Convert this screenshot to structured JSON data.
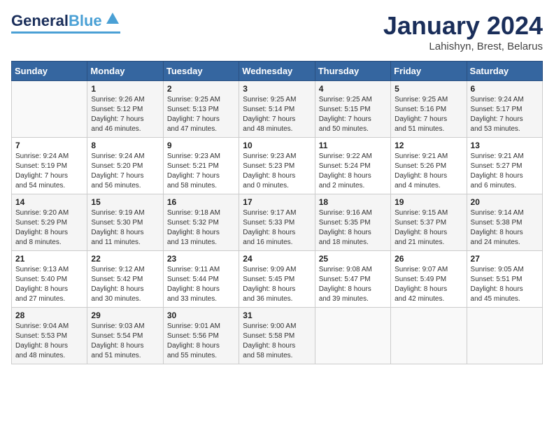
{
  "header": {
    "logo_general": "General",
    "logo_blue": "Blue",
    "month_title": "January 2024",
    "location": "Lahishyn, Brest, Belarus"
  },
  "weekdays": [
    "Sunday",
    "Monday",
    "Tuesday",
    "Wednesday",
    "Thursday",
    "Friday",
    "Saturday"
  ],
  "weeks": [
    [
      {
        "day": "",
        "info": ""
      },
      {
        "day": "1",
        "info": "Sunrise: 9:26 AM\nSunset: 5:12 PM\nDaylight: 7 hours\nand 46 minutes."
      },
      {
        "day": "2",
        "info": "Sunrise: 9:25 AM\nSunset: 5:13 PM\nDaylight: 7 hours\nand 47 minutes."
      },
      {
        "day": "3",
        "info": "Sunrise: 9:25 AM\nSunset: 5:14 PM\nDaylight: 7 hours\nand 48 minutes."
      },
      {
        "day": "4",
        "info": "Sunrise: 9:25 AM\nSunset: 5:15 PM\nDaylight: 7 hours\nand 50 minutes."
      },
      {
        "day": "5",
        "info": "Sunrise: 9:25 AM\nSunset: 5:16 PM\nDaylight: 7 hours\nand 51 minutes."
      },
      {
        "day": "6",
        "info": "Sunrise: 9:24 AM\nSunset: 5:17 PM\nDaylight: 7 hours\nand 53 minutes."
      }
    ],
    [
      {
        "day": "7",
        "info": "Sunrise: 9:24 AM\nSunset: 5:19 PM\nDaylight: 7 hours\nand 54 minutes."
      },
      {
        "day": "8",
        "info": "Sunrise: 9:24 AM\nSunset: 5:20 PM\nDaylight: 7 hours\nand 56 minutes."
      },
      {
        "day": "9",
        "info": "Sunrise: 9:23 AM\nSunset: 5:21 PM\nDaylight: 7 hours\nand 58 minutes."
      },
      {
        "day": "10",
        "info": "Sunrise: 9:23 AM\nSunset: 5:23 PM\nDaylight: 8 hours\nand 0 minutes."
      },
      {
        "day": "11",
        "info": "Sunrise: 9:22 AM\nSunset: 5:24 PM\nDaylight: 8 hours\nand 2 minutes."
      },
      {
        "day": "12",
        "info": "Sunrise: 9:21 AM\nSunset: 5:26 PM\nDaylight: 8 hours\nand 4 minutes."
      },
      {
        "day": "13",
        "info": "Sunrise: 9:21 AM\nSunset: 5:27 PM\nDaylight: 8 hours\nand 6 minutes."
      }
    ],
    [
      {
        "day": "14",
        "info": "Sunrise: 9:20 AM\nSunset: 5:29 PM\nDaylight: 8 hours\nand 8 minutes."
      },
      {
        "day": "15",
        "info": "Sunrise: 9:19 AM\nSunset: 5:30 PM\nDaylight: 8 hours\nand 11 minutes."
      },
      {
        "day": "16",
        "info": "Sunrise: 9:18 AM\nSunset: 5:32 PM\nDaylight: 8 hours\nand 13 minutes."
      },
      {
        "day": "17",
        "info": "Sunrise: 9:17 AM\nSunset: 5:33 PM\nDaylight: 8 hours\nand 16 minutes."
      },
      {
        "day": "18",
        "info": "Sunrise: 9:16 AM\nSunset: 5:35 PM\nDaylight: 8 hours\nand 18 minutes."
      },
      {
        "day": "19",
        "info": "Sunrise: 9:15 AM\nSunset: 5:37 PM\nDaylight: 8 hours\nand 21 minutes."
      },
      {
        "day": "20",
        "info": "Sunrise: 9:14 AM\nSunset: 5:38 PM\nDaylight: 8 hours\nand 24 minutes."
      }
    ],
    [
      {
        "day": "21",
        "info": "Sunrise: 9:13 AM\nSunset: 5:40 PM\nDaylight: 8 hours\nand 27 minutes."
      },
      {
        "day": "22",
        "info": "Sunrise: 9:12 AM\nSunset: 5:42 PM\nDaylight: 8 hours\nand 30 minutes."
      },
      {
        "day": "23",
        "info": "Sunrise: 9:11 AM\nSunset: 5:44 PM\nDaylight: 8 hours\nand 33 minutes."
      },
      {
        "day": "24",
        "info": "Sunrise: 9:09 AM\nSunset: 5:45 PM\nDaylight: 8 hours\nand 36 minutes."
      },
      {
        "day": "25",
        "info": "Sunrise: 9:08 AM\nSunset: 5:47 PM\nDaylight: 8 hours\nand 39 minutes."
      },
      {
        "day": "26",
        "info": "Sunrise: 9:07 AM\nSunset: 5:49 PM\nDaylight: 8 hours\nand 42 minutes."
      },
      {
        "day": "27",
        "info": "Sunrise: 9:05 AM\nSunset: 5:51 PM\nDaylight: 8 hours\nand 45 minutes."
      }
    ],
    [
      {
        "day": "28",
        "info": "Sunrise: 9:04 AM\nSunset: 5:53 PM\nDaylight: 8 hours\nand 48 minutes."
      },
      {
        "day": "29",
        "info": "Sunrise: 9:03 AM\nSunset: 5:54 PM\nDaylight: 8 hours\nand 51 minutes."
      },
      {
        "day": "30",
        "info": "Sunrise: 9:01 AM\nSunset: 5:56 PM\nDaylight: 8 hours\nand 55 minutes."
      },
      {
        "day": "31",
        "info": "Sunrise: 9:00 AM\nSunset: 5:58 PM\nDaylight: 8 hours\nand 58 minutes."
      },
      {
        "day": "",
        "info": ""
      },
      {
        "day": "",
        "info": ""
      },
      {
        "day": "",
        "info": ""
      }
    ]
  ]
}
